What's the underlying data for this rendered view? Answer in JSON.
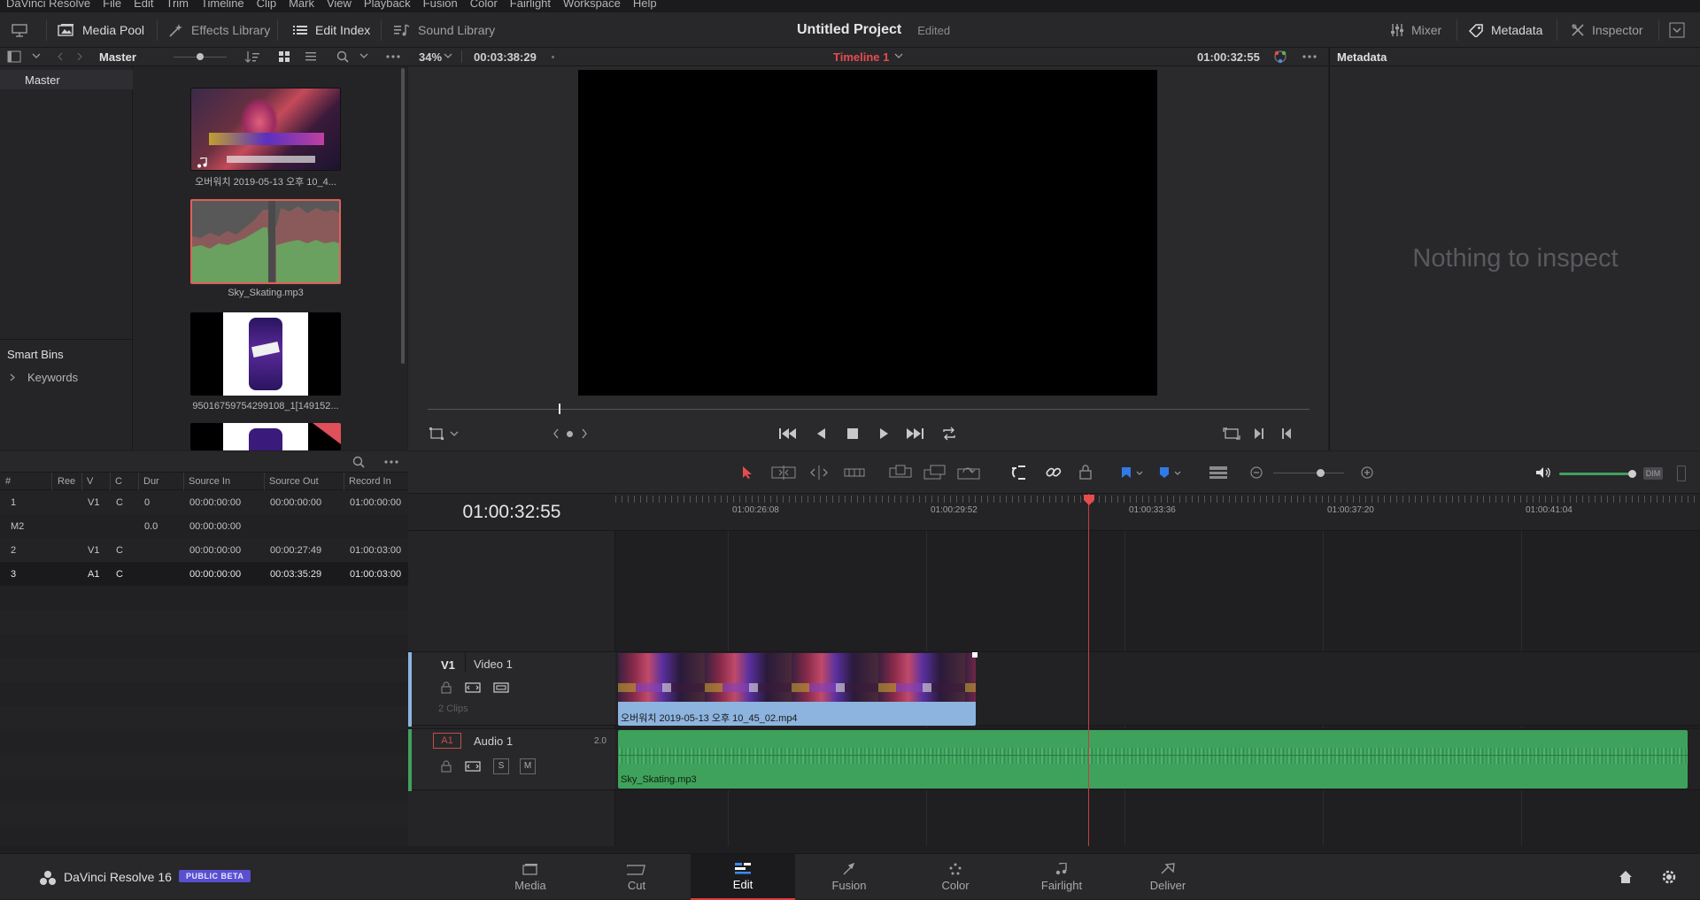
{
  "menu": [
    "DaVinci Resolve",
    "File",
    "Edit",
    "Trim",
    "Timeline",
    "Clip",
    "Mark",
    "View",
    "Playback",
    "Fusion",
    "Color",
    "Fairlight",
    "Workspace",
    "Help"
  ],
  "toolbar": {
    "media_pool": "Media Pool",
    "effects_library": "Effects Library",
    "edit_index": "Edit Index",
    "sound_library": "Sound Library",
    "mixer": "Mixer",
    "metadata": "Metadata",
    "inspector": "Inspector"
  },
  "project": {
    "title": "Untitled Project",
    "status": "Edited"
  },
  "media_pool": {
    "bin_title": "Master",
    "bins": [
      "Master"
    ],
    "smart_bins_title": "Smart Bins",
    "smart_bins": [
      "Keywords"
    ],
    "clips": [
      {
        "name": "오버워치 2019-05-13 오후 10_4...",
        "kind": "video"
      },
      {
        "name": "Sky_Skating.mp3",
        "kind": "audio",
        "selected": true
      },
      {
        "name": "95016759754299108_1[149152...",
        "kind": "image"
      }
    ]
  },
  "viewer": {
    "zoom": "34%",
    "duration": "00:03:38:29",
    "timeline_name": "Timeline 1",
    "timecode": "01:00:32:55"
  },
  "metadata": {
    "title": "Metadata",
    "empty_text": "Nothing to inspect"
  },
  "edit_index": {
    "columns": [
      "#",
      "Ree",
      "V",
      "C",
      "Dur",
      "Source In",
      "Source Out",
      "Record In"
    ],
    "rows": [
      [
        "1",
        "",
        "V1",
        "C",
        "0",
        "00:00:00:00",
        "00:00:00:00",
        "01:00:00:00"
      ],
      [
        "M2",
        "",
        "",
        "",
        "0.0",
        "00:00:00:00",
        "",
        ""
      ],
      [
        "2",
        "",
        "V1",
        "C",
        "",
        "00:00:00:00",
        "00:00:27:49",
        "01:00:03:00"
      ],
      [
        "3",
        "",
        "A1",
        "C",
        "",
        "00:00:00:00",
        "00:03:35:29",
        "01:00:03:00"
      ]
    ]
  },
  "timeline": {
    "timecode": "01:00:32:55",
    "ruler_labels": [
      "01:00:26:08",
      "01:00:29:52",
      "01:00:33:36",
      "01:00:37:20",
      "01:00:41:04"
    ],
    "video_track": {
      "id": "V1",
      "name": "Video 1",
      "clip_count": "2 Clips",
      "clip_name": "오버워치 2019-05-13 오후 10_45_02.mp4"
    },
    "audio_track": {
      "id": "A1",
      "name": "Audio 1",
      "channels": "2.0",
      "solo": "S",
      "mute": "M",
      "clip_name": "Sky_Skating.mp3"
    },
    "dim_label": "DIM",
    "volume_fraction": 0.9
  },
  "bottom_nav": {
    "app_name": "DaVinci Resolve 16",
    "beta_badge": "PUBLIC BETA",
    "pages": [
      "Media",
      "Cut",
      "Edit",
      "Fusion",
      "Color",
      "Fairlight",
      "Deliver"
    ],
    "active_page": "Edit"
  },
  "colors": {
    "accent_red": "#e63c3c",
    "audio_green": "#3fa25c",
    "video_blue": "#8cb4de",
    "beta_purple": "#5a4fcf"
  }
}
